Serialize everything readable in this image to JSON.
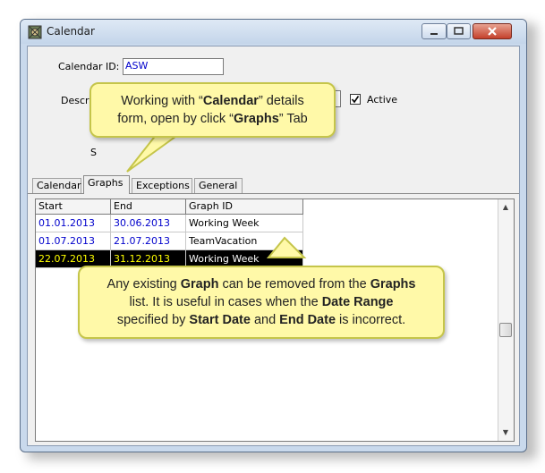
{
  "window": {
    "title": "Calendar"
  },
  "form": {
    "calendar_id_label": "Calendar ID:",
    "calendar_id_value": "ASW",
    "description_label": "Descri",
    "status_label_fragment": "S",
    "active_label": "Active",
    "active_checked": true
  },
  "tabs": [
    {
      "label": "Calendar",
      "active": false
    },
    {
      "label": "Graphs",
      "active": true
    },
    {
      "label": "Exceptions",
      "active": false
    },
    {
      "label": "General",
      "active": false
    }
  ],
  "grid": {
    "headers": [
      "Start",
      "End",
      "Graph ID"
    ],
    "rows": [
      {
        "start": "01.01.2013",
        "end": "30.06.2013",
        "graph_id": "Working Week",
        "selected": false
      },
      {
        "start": "01.07.2013",
        "end": "21.07.2013",
        "graph_id": "TeamVacation",
        "selected": false
      },
      {
        "start": "22.07.2013",
        "end": "31.12.2013",
        "graph_id": "Working Week",
        "selected": true
      }
    ]
  },
  "callout_top": {
    "line1_pre": "Working with “",
    "line1_bold": "Calendar",
    "line1_post": "” details",
    "line2_pre": "form, open by click “",
    "line2_bold": "Graphs",
    "line2_post": "” Tab"
  },
  "callout_bottom": {
    "l1_a": "Any existing ",
    "l1_b": "Graph",
    "l1_c": " can be removed from the ",
    "l1_d": "Graphs",
    "l2_a": "list. It is useful in cases when the ",
    "l2_b": "Date Range",
    "l3_a": "specified by ",
    "l3_b": "Start Date",
    "l3_c": " and ",
    "l3_d": "End Date",
    "l3_e": " is incorrect."
  },
  "colors": {
    "link_blue": "#0000cc",
    "selection_bg": "#000000",
    "selection_text": "#ffff00",
    "callout_bg": "#fff9a8"
  }
}
